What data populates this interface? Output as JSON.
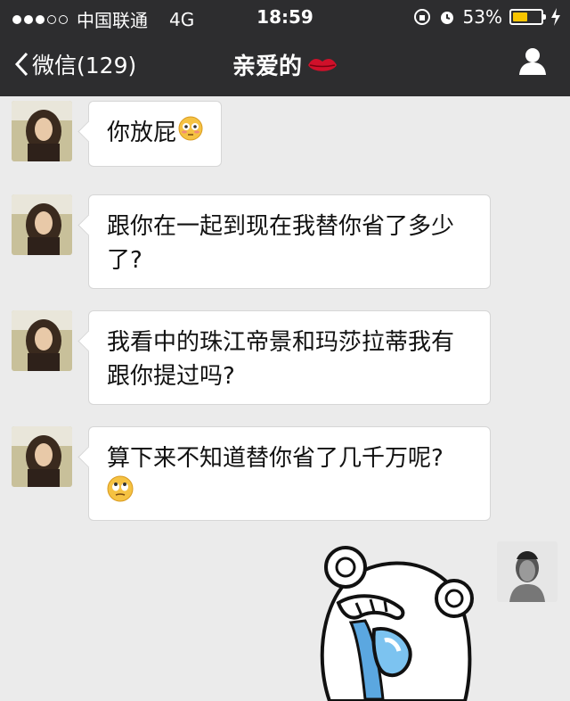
{
  "status": {
    "carrier": "中国联通",
    "network": "4G",
    "time": "18:59",
    "battery": "53%",
    "battery_level": 0.53
  },
  "nav": {
    "back_label": "微信(129)",
    "title": "亲爱的",
    "title_emoji": "lips-icon",
    "profile_icon": "person-icon"
  },
  "messages": [
    {
      "from": "contact",
      "text": "你放屁",
      "emoji": "flushed-face-icon"
    },
    {
      "from": "contact",
      "line1": "跟你在一起到现在我替你省了多少",
      "line2": "了?"
    },
    {
      "from": "contact",
      "line1": "我看中的珠江帝景和玛莎拉蒂我有",
      "line2": "跟你提过吗?"
    },
    {
      "from": "contact",
      "text": "算下来不知道替你省了几千万呢?",
      "emoji": "eye-roll-face-icon"
    },
    {
      "from": "me",
      "type": "sticker",
      "sticker": "crying-bear-facepalm-sticker"
    }
  ],
  "colors": {
    "bar": "#2d2d2f",
    "chat_bg": "#ebebeb",
    "bubble": "#ffffff",
    "battery_fill": "#f7c400",
    "emoji_yellow": "#f5c242"
  }
}
